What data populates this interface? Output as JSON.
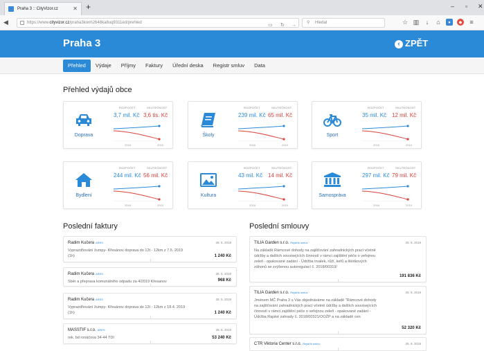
{
  "browser": {
    "tab_title": "Praha 3 :: CityVizor.cz",
    "url_protocol": "https://www.",
    "url_domain": "cityvizor.cz",
    "url_path": "/praha3konh2648ka8uq9311ed/prehled",
    "search_placeholder": "Hledat"
  },
  "site": {
    "title": "Praha 3",
    "back_label": "ZPĚT",
    "accent": "#2a8ad8",
    "nav": [
      "Přehled",
      "Výdaje",
      "Příjmy",
      "Faktury",
      "Úřední deska",
      "Registr smluv",
      "Data"
    ]
  },
  "overview": {
    "heading": "Přehled výdajů obce",
    "label_budget": "ROZPOČET",
    "label_actual": "SKUTEČNOST",
    "year_start": "2018",
    "year_end": "2019",
    "cards": [
      {
        "name": "Doprava",
        "icon": "car-icon",
        "budget": "3,7 mil. Kč",
        "actual": "3,6 tis. Kč"
      },
      {
        "name": "Školy",
        "icon": "book-icon",
        "budget": "239 mil. Kč",
        "actual": "65 mil. Kč"
      },
      {
        "name": "Sport",
        "icon": "bicycle-icon",
        "budget": "35 mil. Kč",
        "actual": "12 mil. Kč"
      },
      {
        "name": "Bydlení",
        "icon": "home-icon",
        "budget": "244 mil. Kč",
        "actual": "56 mil. Kč"
      },
      {
        "name": "Kultura",
        "icon": "picture-icon",
        "budget": "43 mil. Kč",
        "actual": "14 mil. Kč"
      },
      {
        "name": "Samospráva",
        "icon": "institution-icon",
        "budget": "297 mil. Kč",
        "actual": "79 mil. Kč"
      }
    ]
  },
  "invoices": {
    "heading": "Poslední faktury",
    "ares_label": "ARES",
    "items": [
      {
        "name": "Radim Kučera",
        "date": "28. 5. 2019",
        "desc": "Vyprazdňování žumpy- Křesánov doprava do 12t - 12km z 7.5. 2019 (1h)",
        "amount": "1 240 Kč"
      },
      {
        "name": "Radim Kučera",
        "date": "28. 5. 2019",
        "desc": "Sběr a přeprava komunálního odpadu za 4/2019 Křesanov",
        "amount": "968 Kč"
      },
      {
        "name": "Radim Kučera",
        "date": "28. 5. 2019",
        "desc": "Vyprazdňování žumpy- Křesánov doprava do 12t - 12km z 18.4. 2019 (1h)",
        "amount": "1 240 Kč"
      },
      {
        "name": "MASSTIF s.r.o.",
        "date": "28. 5. 2019",
        "desc": "rek. bd ronáčova 34-44 TDI",
        "amount": "53 240 Kč"
      }
    ]
  },
  "contracts": {
    "heading": "Poslední smlouvy",
    "registry_label": "Rejstřík smluv",
    "items": [
      {
        "name": "TILIA Garden s.r.o.",
        "date": "25. 6. 2019",
        "desc": "Na základě Rámcové dohody na zajišťování zahradnických prací včetně údržby a dalších souvisejících činností v rámci zajištění péče o veřejnou zeleň - opakované zadání - Údržba trvalek, růží, keřů a šlérikových záhonů se zvýšenou autoregulací č. 2018/00319/",
        "amount": "191 836 Kč"
      },
      {
        "name": "TILIA Garden s.r.o.",
        "date": "25. 6. 2019",
        "desc": "Jménem MČ Praha 3 u Vás objednáváme na základě \"Rámcové dohody na zajišťování zahradnických prací včetně údržby a dalších souvisejících činností v rámci zajištění péče o veřejnou zeleň - opakované zadání - Údržba Rajské zahrady č. 2018/00321/OOŽP a na základě cen",
        "amount": "52 320 Kč"
      },
      {
        "name": "CTR Viktoria Center s.r.o.",
        "date": "25. 6. 2019",
        "desc": "",
        "amount": ""
      }
    ]
  }
}
